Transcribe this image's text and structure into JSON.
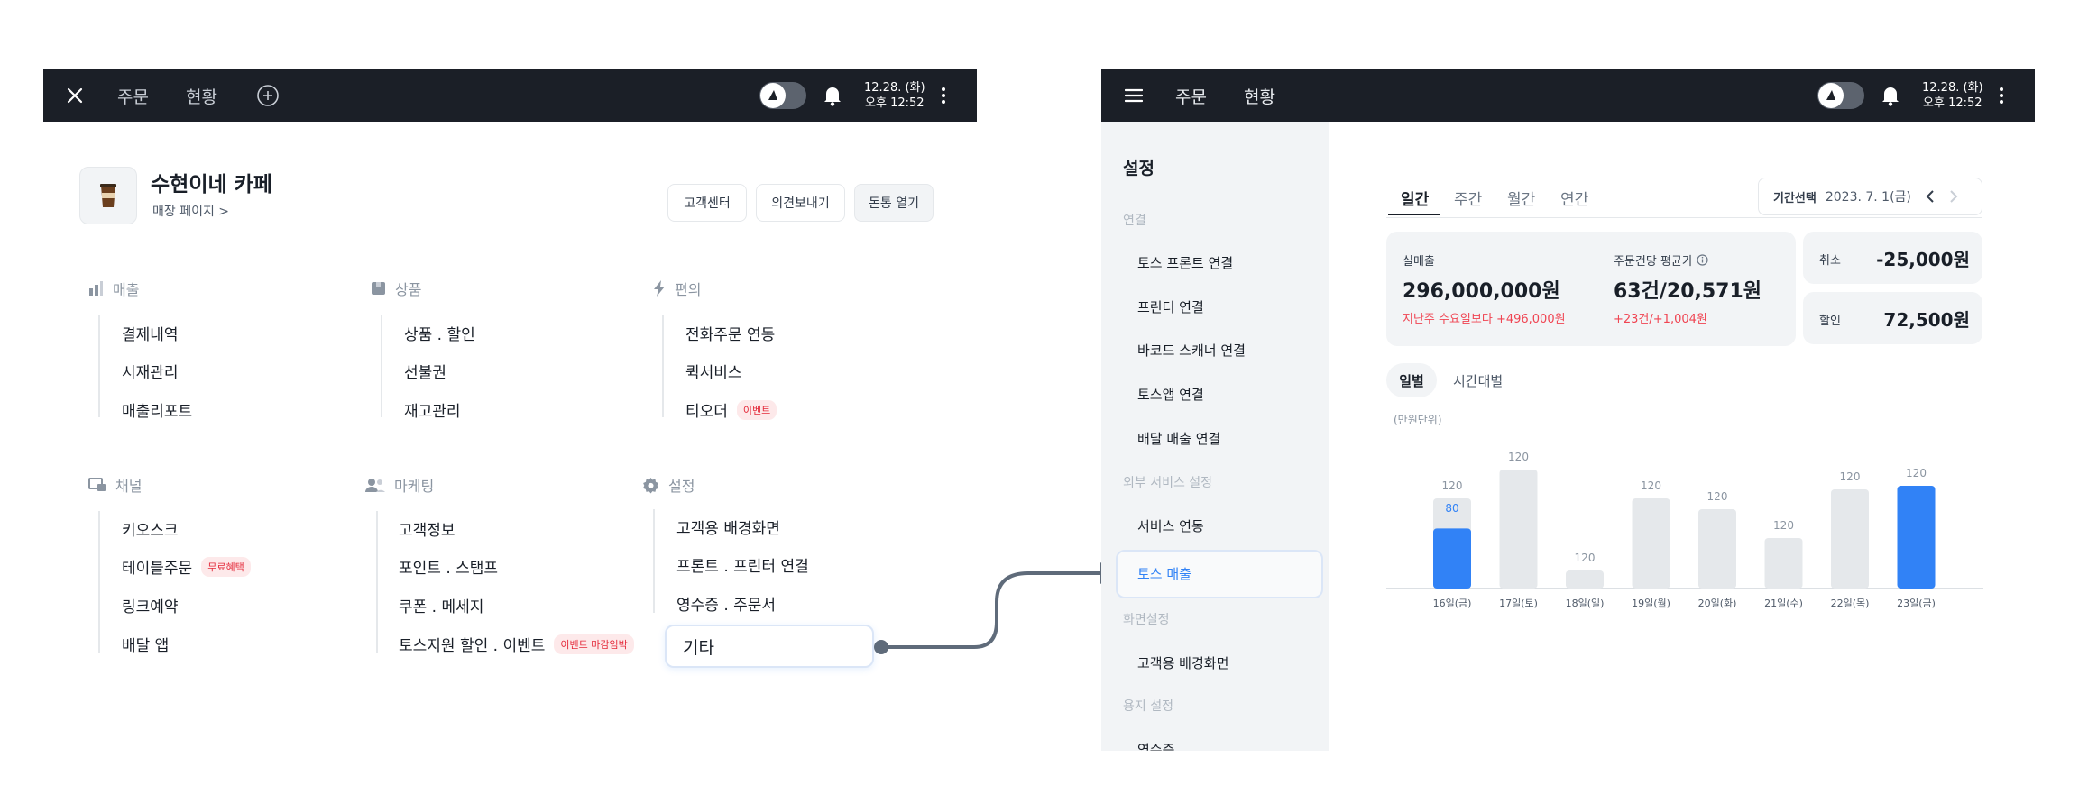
{
  "left": {
    "topbar": {
      "tabs": [
        "주문",
        "현황"
      ],
      "date": "12.28. (화)",
      "time": "오후 12:52"
    },
    "store": {
      "name": "수현이네 카페",
      "page_link": "매장 페이지 >"
    },
    "buttons": [
      "고객센터",
      "의견보내기",
      "돈통 열기"
    ],
    "sections": [
      {
        "title": "매출",
        "icon": "chart-icon",
        "items": [
          {
            "label": "결제내역"
          },
          {
            "label": "시재관리"
          },
          {
            "label": "매출리포트"
          }
        ]
      },
      {
        "title": "상품",
        "icon": "box-icon",
        "items": [
          {
            "label": "상품 . 할인"
          },
          {
            "label": "선불권"
          },
          {
            "label": "재고관리"
          }
        ]
      },
      {
        "title": "편의",
        "icon": "lightning-icon",
        "items": [
          {
            "label": "전화주문 연동"
          },
          {
            "label": "퀵서비스"
          },
          {
            "label": "티오더",
            "badge": "이벤트"
          }
        ]
      },
      {
        "title": "채널",
        "icon": "channel-icon",
        "items": [
          {
            "label": "키오스크"
          },
          {
            "label": "테이블주문",
            "badge": "무료혜택"
          },
          {
            "label": "링크예약"
          },
          {
            "label": "배달 앱"
          }
        ]
      },
      {
        "title": "마케팅",
        "icon": "people-icon",
        "items": [
          {
            "label": "고객정보"
          },
          {
            "label": "포인트 . 스탬프"
          },
          {
            "label": "쿠폰 . 메세지"
          },
          {
            "label": "토스지원 할인 . 이벤트",
            "badge": "이벤트 마감임박"
          }
        ]
      },
      {
        "title": "설정",
        "icon": "gear-icon",
        "items": [
          {
            "label": "고객용 배경화면"
          },
          {
            "label": "프론트 . 프린터 연결"
          },
          {
            "label": "영수증 . 주문서"
          },
          {
            "label": "기타"
          }
        ]
      }
    ]
  },
  "right": {
    "topbar": {
      "tabs": [
        "주문",
        "현황"
      ],
      "date": "12.28. (화)",
      "time": "오후 12:52"
    },
    "sidebar": {
      "title": "설정",
      "groups": [
        {
          "header": "연결",
          "items": [
            "토스 프론트 연결",
            "프린터 연결",
            "바코드 스캐너 연결",
            "토스앱 연결",
            "배달 매출 연결"
          ]
        },
        {
          "header": "외부 서비스 설정",
          "items": [
            "서비스 연동",
            "토스 매출"
          ]
        },
        {
          "header": "화면설정",
          "items": [
            "고객용 배경화면"
          ]
        },
        {
          "header": "용지 설정",
          "items": [
            "영수증"
          ]
        }
      ],
      "selected": "토스 매출"
    },
    "period_tabs": [
      "일간",
      "주간",
      "월간",
      "연간"
    ],
    "date_picker": {
      "label": "기간선택",
      "value": "2023. 7. 1(금)"
    },
    "stats": {
      "sales_label": "실매출",
      "sales_value": "296,000,000원",
      "sales_delta": "지난주 수요일보다 +496,000원",
      "avg_label": "주문건당 평균가",
      "avg_value": "63건/20,571원",
      "avg_delta": "+23건/+1,004원",
      "cancel_label": "취소",
      "cancel_value": "-25,000원",
      "discount_label": "할인",
      "discount_value": "72,500원"
    },
    "view_tabs": [
      "일별",
      "시간대별"
    ],
    "unit_note": "(만원단위)"
  },
  "colors": {
    "accent": "#3182f6",
    "topbar": "#1b1f27",
    "bar_gray": "#e5e8eb",
    "red": "#f04452"
  },
  "chart_data": {
    "type": "bar",
    "categories": [
      "16일(금)",
      "17일(토)",
      "18일(일)",
      "19일(월)",
      "20일(화)",
      "21일(수)",
      "22일(목)",
      "23일(금)"
    ],
    "series": [
      {
        "values": [
          120,
          120,
          120,
          120,
          120,
          120,
          120,
          120
        ]
      },
      {
        "values": [
          80,
          null,
          null,
          null,
          null,
          null,
          null,
          120
        ]
      }
    ],
    "data_labels": [
      "120",
      "120",
      "120",
      "120",
      "120",
      "120",
      "120",
      "120"
    ],
    "highlight_labels": [
      "80"
    ],
    "unit": "(만원단위)"
  }
}
